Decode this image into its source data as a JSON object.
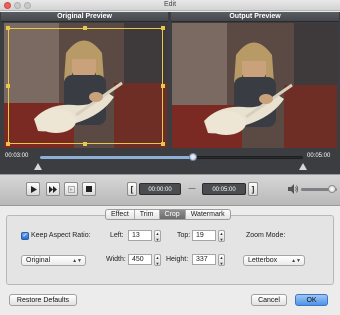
{
  "window": {
    "title": "Edit"
  },
  "preview": {
    "original_label": "Original Preview",
    "output_label": "Output Preview"
  },
  "timeline": {
    "current_time": "00:03:00",
    "end_time": "00:05:00",
    "position": 0.58
  },
  "playback": {
    "play_icon": "play-icon",
    "next_frame_icon": "next-frame-icon",
    "clip_icon": "clip-icon",
    "stop_icon": "stop-icon",
    "start_time": "00:00:00",
    "end_time": "00:05:00",
    "volume_level": 0.85
  },
  "tabs": [
    {
      "label": "Effect",
      "active": false
    },
    {
      "label": "Trim",
      "active": false
    },
    {
      "label": "Crop",
      "active": true
    },
    {
      "label": "Watermark",
      "active": false
    }
  ],
  "crop": {
    "keep_aspect_label": "Keep Aspect Ratio:",
    "keep_aspect_checked": true,
    "left_label": "Left:",
    "left_value": "13",
    "top_label": "Top:",
    "top_value": "19",
    "zoom_label": "Zoom Mode:",
    "aspect_value": "Original",
    "width_label": "Width:",
    "width_value": "450",
    "height_label": "Height:",
    "height_value": "337",
    "zoom_value": "Letterbox"
  },
  "buttons": {
    "restore": "Restore Defaults",
    "cancel": "Cancel",
    "ok": "OK"
  },
  "colors": {
    "accent": "#4f93e8",
    "crop_frame": "#e8c84a"
  }
}
